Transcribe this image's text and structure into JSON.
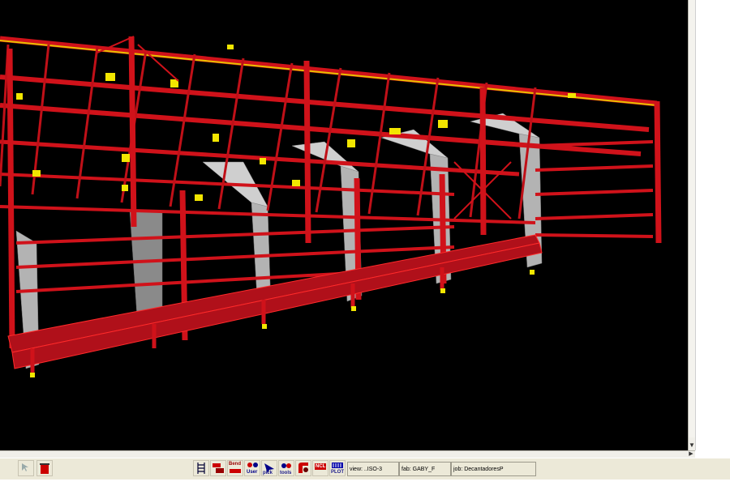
{
  "toolbar": {
    "buttons": [
      {
        "icon": "ladder-list-icon"
      },
      {
        "icon": "member-tool-icon"
      },
      {
        "icon": "bend-tool-icon",
        "label": "Bend"
      },
      {
        "icon": "user-tool-icon",
        "label": "User"
      },
      {
        "icon": "pick-tool-icon",
        "label": "pick"
      },
      {
        "icon": "tools-menu-icon",
        "label": "tools"
      },
      {
        "icon": "plate-tool-icon"
      },
      {
        "icon": "ncl-tool-icon",
        "label": "NCL"
      },
      {
        "icon": "plot-tool-icon",
        "label": "PLOT"
      }
    ]
  },
  "status": {
    "view": "view: ..ISO-3",
    "fab": "fab: GABY_F",
    "job": "job: DecantadoresP"
  },
  "colors": {
    "background": "#000000",
    "steel_red": "#d0121a",
    "connection_yellow": "#f2e600",
    "column_gray": "#b8b8b8"
  }
}
